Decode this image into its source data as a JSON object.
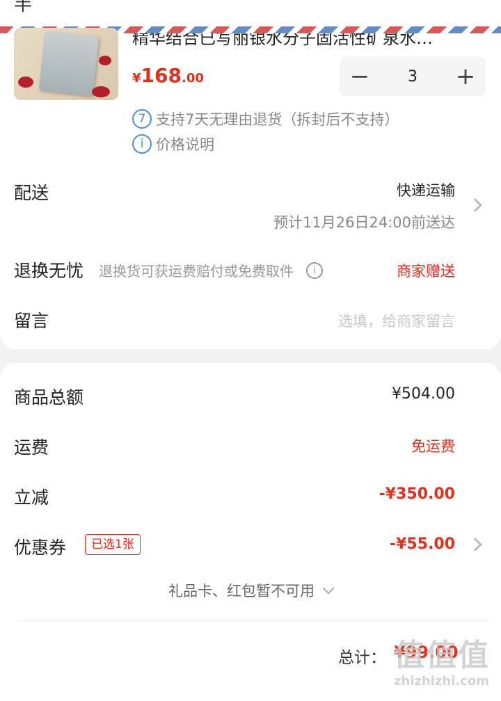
{
  "top_glyph": "半",
  "product": {
    "title": "精华结合已写丽银水分子固活性矿泉水…",
    "price_currency": "¥",
    "price_int": "168",
    "price_dec": ".00",
    "qty_minus": "−",
    "quantity": "3",
    "qty_plus": "+",
    "return_badge": "7",
    "return_policy": "支持7天无理由退货（拆封后不支持）",
    "info_badge": "i",
    "price_note": "价格说明"
  },
  "delivery": {
    "label": "配送",
    "method": "快递运输",
    "estimate": "预计11月26日24:00前送达"
  },
  "returns": {
    "label": "退换无忧",
    "desc": "退换货可获运费赔付或免费取件",
    "info_badge": "i",
    "value": "商家赠送"
  },
  "message": {
    "label": "留言",
    "placeholder": "选填，给商家留言"
  },
  "summary": {
    "subtotal_label": "商品总额",
    "subtotal_value": "¥504.00",
    "shipping_label": "运费",
    "shipping_value": "免运费",
    "discount_label": "立减",
    "discount_value": "-¥350.00",
    "coupon_label": "优惠券",
    "coupon_tag": "已选1张",
    "coupon_value": "-¥55.00",
    "gift_note": "礼品卡、红包暂不可用",
    "total_label": "总计：",
    "total_value": "¥99.00"
  },
  "watermark": {
    "top": "值值值",
    "bottom": "zhizhizhi.com"
  },
  "colors": {
    "accent_red": "#e0301e",
    "info_blue": "#4b8fd6",
    "page_bg": "#f2f2f2"
  }
}
